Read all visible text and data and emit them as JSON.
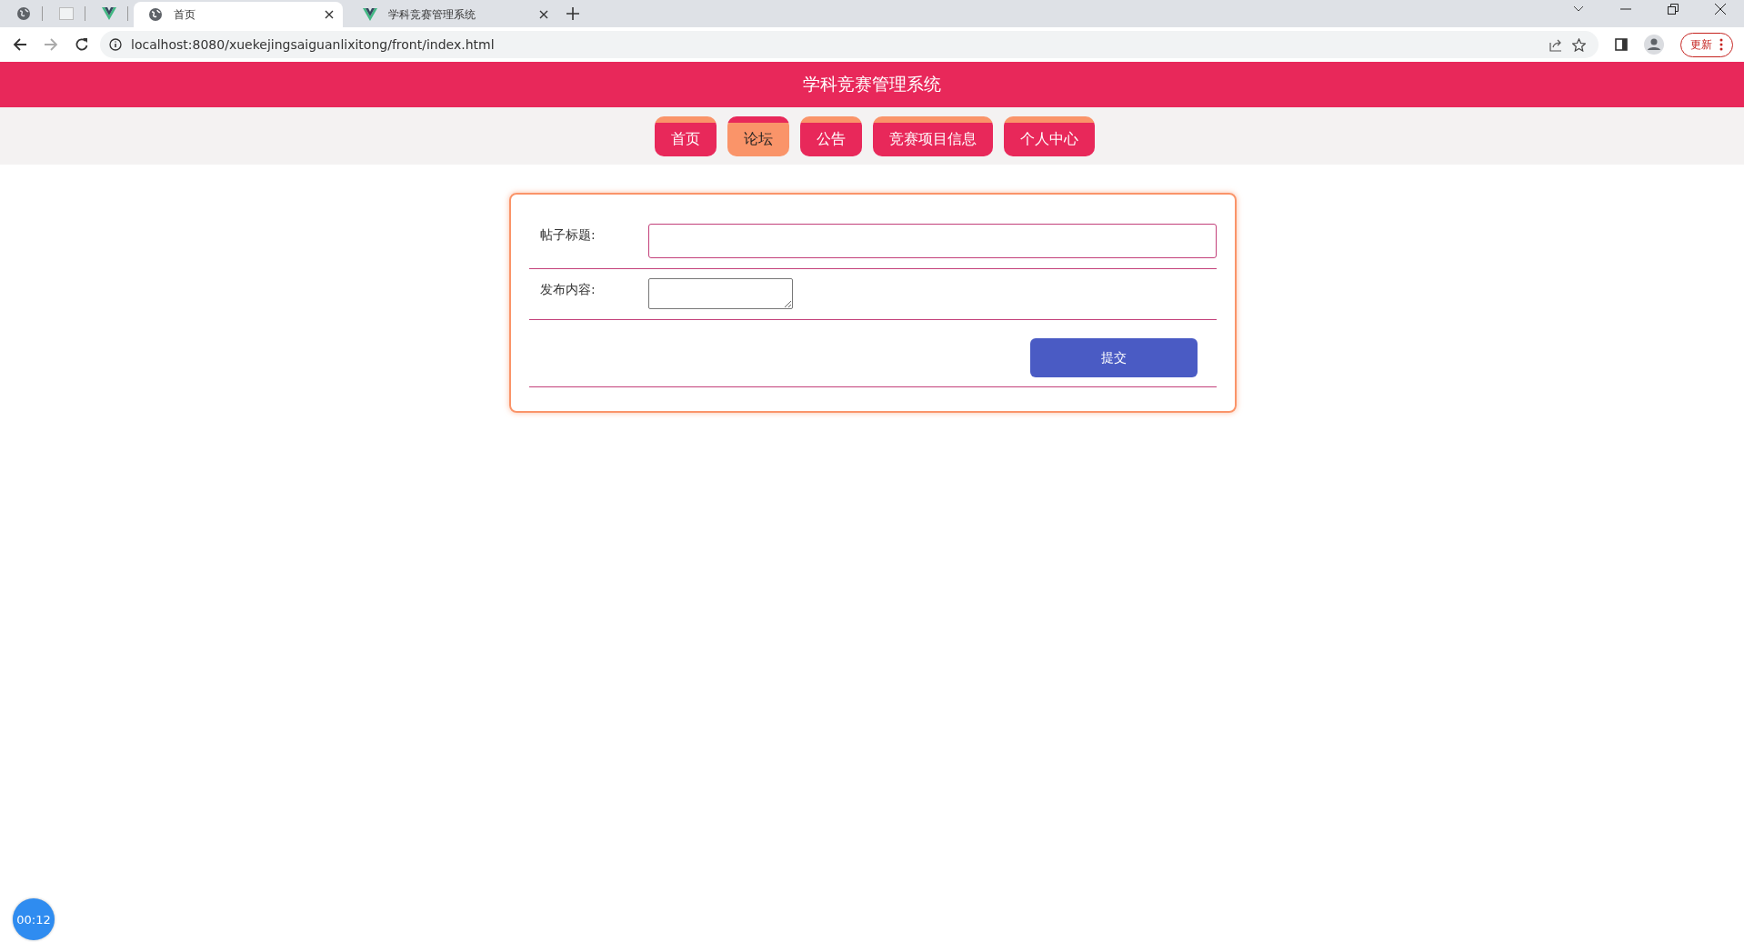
{
  "browser": {
    "pinned_tabs": [
      {
        "kind": "globe"
      },
      {
        "kind": "blank"
      },
      {
        "kind": "vue"
      }
    ],
    "tabs": [
      {
        "title": "首页",
        "kind": "globe",
        "selected": true
      },
      {
        "title": "学科竞赛管理系统",
        "kind": "vue",
        "selected": false
      }
    ],
    "url": "localhost:8080/xuekejingsaiguanlixitong/front/index.html",
    "update_button": "更新"
  },
  "header": {
    "title": "学科竞赛管理系统"
  },
  "nav": [
    {
      "label": "首页",
      "selected": false
    },
    {
      "label": "论坛",
      "selected": true
    },
    {
      "label": "公告",
      "selected": false
    },
    {
      "label": "竞赛项目信息",
      "selected": false
    },
    {
      "label": "个人中心",
      "selected": false
    }
  ],
  "form": {
    "fields": [
      {
        "label": "帖子标题:",
        "kind": "input"
      },
      {
        "label": "发布内容:",
        "kind": "textarea"
      }
    ],
    "submit": "提交"
  },
  "timer": "00:12"
}
